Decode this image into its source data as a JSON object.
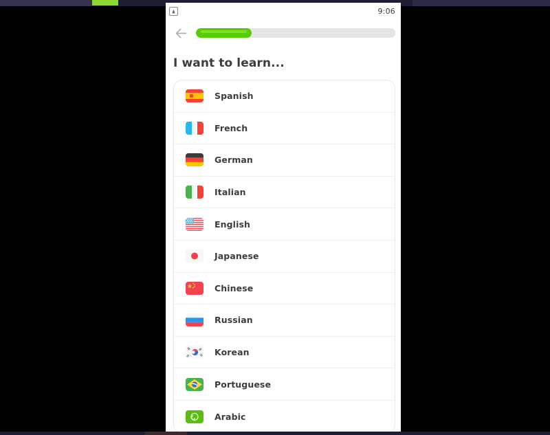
{
  "window": {
    "background_color": "#000000",
    "chrome_color": "#242440",
    "accent_green": "#8bd830"
  },
  "phone": {
    "status_bar": {
      "icon_name": "app-notification-icon",
      "time": "9:06"
    },
    "header": {
      "back_icon": "back-arrow-icon",
      "progress": {
        "percent": 28,
        "fill_color": "#58cc02",
        "track_color": "#e5e5e5"
      }
    },
    "title": "I want to learn...",
    "languages": [
      {
        "label": "Spanish",
        "flag": "flag-spain"
      },
      {
        "label": "French",
        "flag": "flag-france"
      },
      {
        "label": "German",
        "flag": "flag-germany"
      },
      {
        "label": "Italian",
        "flag": "flag-italy"
      },
      {
        "label": "English",
        "flag": "flag-usa"
      },
      {
        "label": "Japanese",
        "flag": "flag-japan"
      },
      {
        "label": "Chinese",
        "flag": "flag-china"
      },
      {
        "label": "Russian",
        "flag": "flag-russia"
      },
      {
        "label": "Korean",
        "flag": "flag-south-korea"
      },
      {
        "label": "Portuguese",
        "flag": "flag-brazil"
      },
      {
        "label": "Arabic",
        "flag": "flag-arabic"
      }
    ]
  }
}
